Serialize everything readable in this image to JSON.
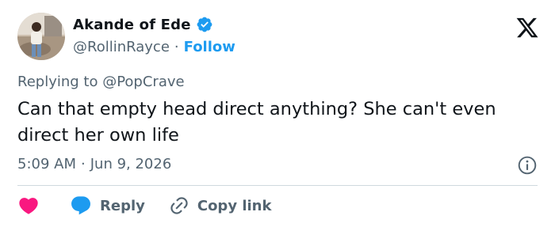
{
  "author": {
    "name": "Akande of Ede",
    "handle": "@RollinRayce",
    "separator": "·",
    "follow_label": "Follow"
  },
  "reply_context": {
    "prefix": "Replying to ",
    "mention": "@PopCrave"
  },
  "tweet": {
    "text": "Can that empty head direct anything? She can't even direct her own life",
    "time": "5:09 AM",
    "separator": "·",
    "date": "Jun 9, 2026"
  },
  "actions": {
    "reply_label": "Reply",
    "copy_link_label": "Copy link"
  },
  "colors": {
    "accent": "#1d9bf0",
    "like": "#f91880",
    "text": "#0f1419",
    "secondary": "#536471"
  },
  "icons": [
    "verified-badge-icon",
    "x-logo-icon",
    "info-icon",
    "heart-icon",
    "reply-bubble-icon",
    "link-icon"
  ]
}
